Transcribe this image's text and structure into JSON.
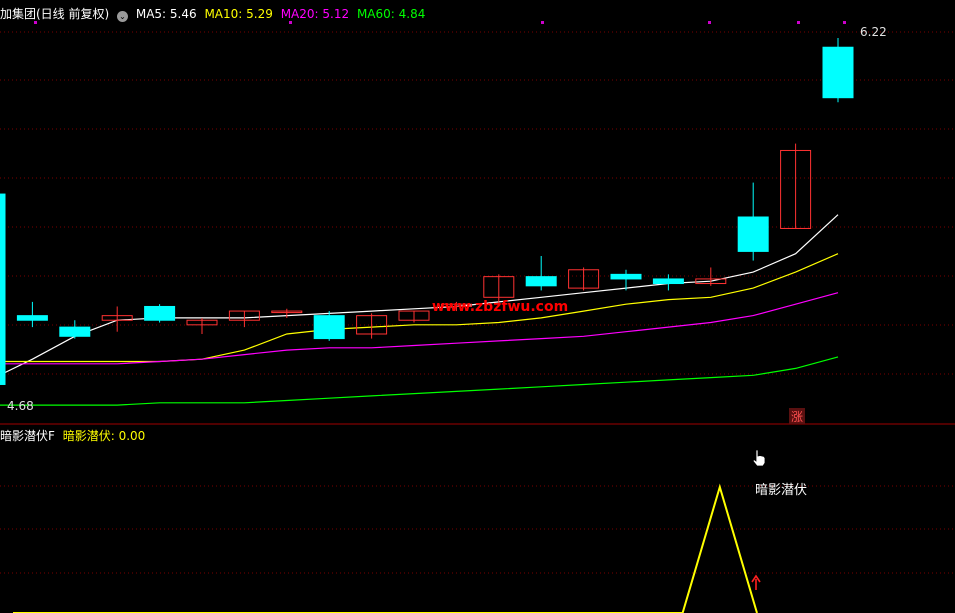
{
  "header": {
    "title": "加集团(日线 前复权)",
    "ma5_label": "MA5: 5.46",
    "ma10_label": "MA10: 5.29",
    "ma20_label": "MA20: 5.12",
    "ma60_label": "MA60: 4.84",
    "gear_icon": "settings-circle-icon"
  },
  "colors": {
    "background": "#000000",
    "grid": "#7a0000",
    "up": "#ff3232",
    "down": "#00ffff",
    "ma5": "#ffffff",
    "ma10": "#ffff00",
    "ma20": "#ff00ff",
    "ma60": "#00ff00",
    "signal": "#ffff00",
    "watermark": "#ff0000",
    "marker": "#cc00cc"
  },
  "price_labels": {
    "high": "6.22",
    "low": "4.68"
  },
  "limit_badge": "涨",
  "watermark": "www.zbzfwu.com",
  "indicator": {
    "name_label": "暗影潜伏F",
    "value_label": "暗影潜伏: 0.00",
    "signal_label": "暗影潜伏"
  },
  "chart_data": [
    {
      "type": "candlestick",
      "title": "加集团(日线 前复权)",
      "ylim": [
        4.6,
        6.3
      ],
      "candles": [
        {
          "o": 5.55,
          "h": 5.56,
          "l": 4.68,
          "c": 4.72
        },
        {
          "o": 5.02,
          "h": 5.08,
          "l": 4.97,
          "c": 5.0
        },
        {
          "o": 4.97,
          "h": 5.0,
          "l": 4.92,
          "c": 4.93
        },
        {
          "o": 5.0,
          "h": 5.06,
          "l": 4.95,
          "c": 5.02
        },
        {
          "o": 5.06,
          "h": 5.07,
          "l": 4.99,
          "c": 5.0
        },
        {
          "o": 4.98,
          "h": 5.01,
          "l": 4.94,
          "c": 5.0
        },
        {
          "o": 5.0,
          "h": 5.04,
          "l": 4.97,
          "c": 5.04
        },
        {
          "o": 5.04,
          "h": 5.05,
          "l": 5.01,
          "c": 5.04
        },
        {
          "o": 5.02,
          "h": 5.04,
          "l": 4.91,
          "c": 4.92
        },
        {
          "o": 4.94,
          "h": 5.03,
          "l": 4.92,
          "c": 5.02
        },
        {
          "o": 5.0,
          "h": 5.04,
          "l": 4.99,
          "c": 5.04
        },
        {
          "o": 5.06,
          "h": 5.08,
          "l": 5.04,
          "c": 5.07
        },
        {
          "o": 5.1,
          "h": 5.2,
          "l": 5.06,
          "c": 5.19
        },
        {
          "o": 5.19,
          "h": 5.28,
          "l": 5.13,
          "c": 5.15
        },
        {
          "o": 5.14,
          "h": 5.23,
          "l": 5.13,
          "c": 5.22
        },
        {
          "o": 5.2,
          "h": 5.22,
          "l": 5.13,
          "c": 5.18
        },
        {
          "o": 5.18,
          "h": 5.2,
          "l": 5.13,
          "c": 5.16
        },
        {
          "o": 5.16,
          "h": 5.23,
          "l": 5.15,
          "c": 5.18
        },
        {
          "o": 5.45,
          "h": 5.6,
          "l": 5.26,
          "c": 5.3
        },
        {
          "o": 5.4,
          "h": 5.77,
          "l": 5.4,
          "c": 5.74
        },
        {
          "o": 6.19,
          "h": 6.23,
          "l": 5.95,
          "c": 5.97
        }
      ],
      "series": [
        {
          "name": "MA5",
          "values": [
            4.74,
            4.83,
            4.93,
            5.0,
            5.01,
            5.01,
            5.01,
            5.02,
            5.03,
            5.04,
            5.05,
            5.06,
            5.08,
            5.1,
            5.12,
            5.14,
            5.16,
            5.17,
            5.21,
            5.29,
            5.46
          ]
        },
        {
          "name": "MA10",
          "values": [
            4.82,
            4.82,
            4.82,
            4.82,
            4.82,
            4.83,
            4.87,
            4.94,
            4.96,
            4.97,
            4.98,
            4.98,
            4.99,
            5.01,
            5.04,
            5.07,
            5.09,
            5.1,
            5.14,
            5.21,
            5.29
          ]
        },
        {
          "name": "MA20",
          "values": [
            4.81,
            4.81,
            4.81,
            4.81,
            4.82,
            4.83,
            4.85,
            4.87,
            4.88,
            4.88,
            4.89,
            4.9,
            4.91,
            4.92,
            4.93,
            4.95,
            4.97,
            4.99,
            5.02,
            5.07,
            5.12
          ]
        },
        {
          "name": "MA60",
          "values": [
            4.63,
            4.63,
            4.63,
            4.63,
            4.64,
            4.64,
            4.64,
            4.65,
            4.66,
            4.67,
            4.68,
            4.69,
            4.7,
            4.71,
            4.72,
            4.73,
            4.74,
            4.75,
            4.76,
            4.79,
            4.84
          ]
        }
      ]
    },
    {
      "type": "line",
      "title": "暗影潜伏F",
      "series": [
        {
          "name": "暗影潜伏",
          "values": [
            0,
            0,
            0,
            0,
            0,
            0,
            0,
            0,
            0,
            0,
            0,
            0,
            0,
            0,
            0,
            0,
            0,
            0,
            0,
            1,
            0
          ]
        }
      ]
    }
  ]
}
